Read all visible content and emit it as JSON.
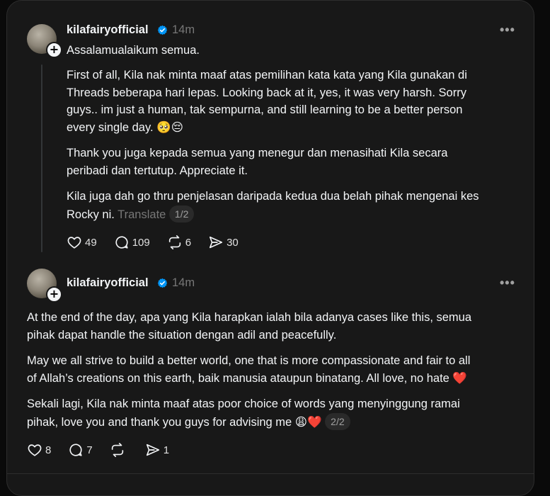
{
  "posts": [
    {
      "username": "kilafairyofficial",
      "time": "14m",
      "greeting": "Assalamualaikum semua.",
      "paragraphs": [
        "First of all, Kila nak minta maaf atas pemilihan kata kata yang Kila gunakan di",
        "Threads beberapa hari lepas. Looking back at it, yes, it was very harsh. Sorry",
        "guys.. im just a human, tak sempurna, and still learning to be a better person",
        "every single day. 🥺😔",
        "Thank you juga kepada semua yang menegur dan menasihati Kila secara",
        "peribadi dan tertutup. Appreciate it.",
        "Kila juga dah go thru penjelasan daripada kedua dua belah pihak mengenai kes",
        "Rocky ni."
      ],
      "translate": "Translate",
      "pager": "1/2",
      "likes": "49",
      "replies": "109",
      "reposts": "6",
      "shares": "30"
    },
    {
      "username": "kilafairyofficial",
      "time": "14m",
      "paragraphs": [
        "At the end of the day, apa yang Kila harapkan ialah bila adanya cases like this, semua",
        "pihak dapat handle the situation dengan adil and peacefully.",
        "May we all strive to build a better world, one that is more compassionate and fair to all",
        "of Allah’s creations on this earth, baik manusia ataupun binatang. All love, no hate ❤️",
        "Sekali lagi, Kila nak minta maaf atas poor choice of words yang menyinggung ramai",
        "pihak, love you and thank you guys for advising me 😩❤️"
      ],
      "pager": "2/2",
      "likes": "8",
      "replies": "7",
      "reposts": "",
      "shares": "1"
    }
  ],
  "icons": {
    "verified_color": "#0095f6",
    "like": "heart-icon",
    "reply": "comment-icon",
    "repost": "repost-icon",
    "share": "share-icon",
    "more": "more-icon"
  }
}
